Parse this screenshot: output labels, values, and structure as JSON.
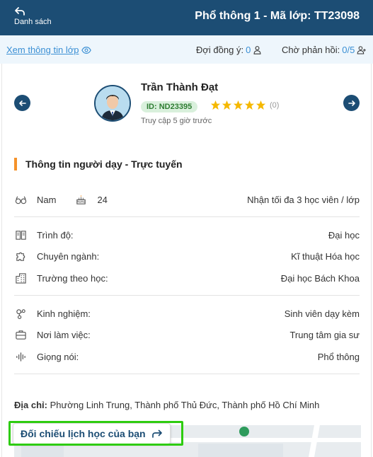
{
  "header": {
    "back_label": "Danh sách",
    "title": "Phổ thông 1 - Mã lớp: TT23098"
  },
  "infobar": {
    "view_info_label": "Xem thông tin lớp",
    "agree_label": "Đợi đồng ý:",
    "agree_count": "0",
    "waiting_label": "Chờ phản hồi:",
    "waiting_count": "0/5"
  },
  "tutor": {
    "name": "Trần Thành Đạt",
    "id_badge": "ID: ND23395",
    "rating": 5,
    "review_count": "(0)",
    "last_access": "Truy cập 5 giờ trước"
  },
  "section": {
    "title": "Thông tin người dạy - Trực tuyến"
  },
  "basic": {
    "gender": "Nam",
    "age": "24",
    "capacity": "Nhận tối đa 3 học viên / lớp"
  },
  "details": {
    "level_label": "Trình độ:",
    "level_value": "Đại học",
    "major_label": "Chuyên ngành:",
    "major_value": "Kĩ thuật Hóa học",
    "school_label": "Trường theo học:",
    "school_value": "Đại học Bách Khoa",
    "experience_label": "Kinh nghiệm:",
    "experience_value": "Sinh viên dạy kèm",
    "workplace_label": "Nơi làm việc:",
    "workplace_value": "Trung tâm gia sư",
    "voice_label": "Giọng nói:",
    "voice_value": "Phổ thông"
  },
  "address": {
    "label": "Địa chỉ:",
    "value": "Phường Linh Trung, Thành phố Thủ Đức, Thành phố Hồ Chí Minh"
  },
  "actions": {
    "compare_label": "Đối chiếu lịch học của bạn"
  },
  "colors": {
    "primary": "#1c4d74",
    "accent": "#f5922a",
    "link": "#3a8fd4",
    "star": "#f5b800",
    "highlight": "#2ecc0f"
  }
}
